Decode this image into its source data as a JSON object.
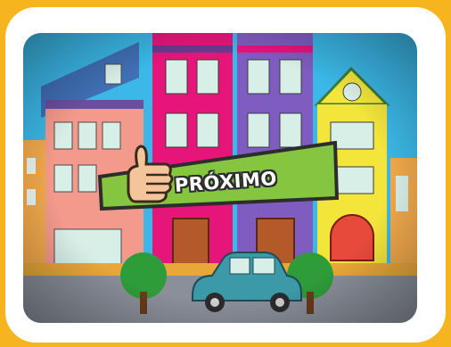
{
  "next_button": {
    "label": "PRÓXIMO",
    "icon": "thumbs-up-icon"
  },
  "colors": {
    "background": "#f6b51e",
    "frame": "#ffffff",
    "sky": "#3bb8e8",
    "banner": "#86c540",
    "banner_outline": "#2d2d2d",
    "car": "#3c9aa8"
  }
}
